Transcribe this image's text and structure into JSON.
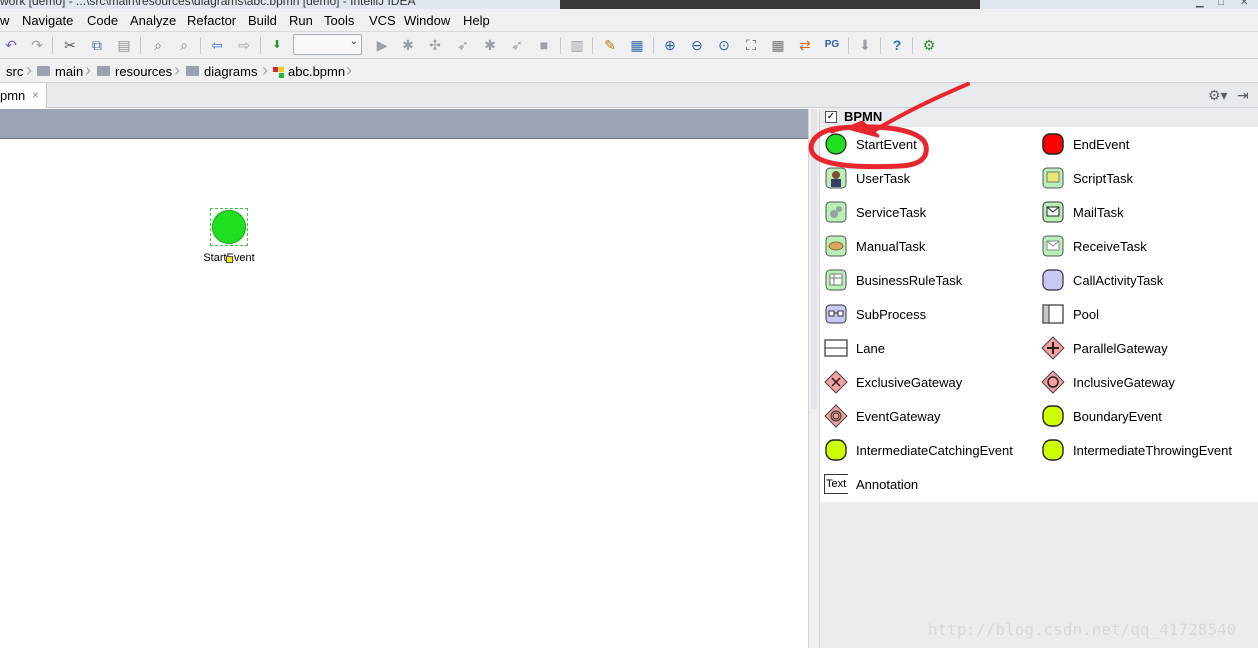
{
  "window": {
    "title": "work [demo] - ...\\src\\main\\resources\\diagrams\\abc.bpmn [demo] - IntelliJ IDEA"
  },
  "menu": {
    "items": [
      "w",
      "Navigate",
      "Code",
      "Analyze",
      "Refactor",
      "Build",
      "Run",
      "Tools",
      "VCS",
      "Window",
      "Help"
    ]
  },
  "toolbar": {
    "combo_value": ""
  },
  "breadcrumbs": [
    "src",
    "main",
    "resources",
    "diagrams",
    "abc.bpmn"
  ],
  "editor": {
    "tab_label": "pmn",
    "tab_close": "×",
    "node_label": "StartEvent"
  },
  "palette": {
    "section_label": "BPMN",
    "section_checked": "✓",
    "items": [
      {
        "label": "StartEvent",
        "icon": "start-event-icon"
      },
      {
        "label": "EndEvent",
        "icon": "end-event-icon"
      },
      {
        "label": "UserTask",
        "icon": "user-task-icon"
      },
      {
        "label": "ScriptTask",
        "icon": "script-task-icon"
      },
      {
        "label": "ServiceTask",
        "icon": "service-task-icon"
      },
      {
        "label": "MailTask",
        "icon": "mail-task-icon"
      },
      {
        "label": "ManualTask",
        "icon": "manual-task-icon"
      },
      {
        "label": "ReceiveTask",
        "icon": "receive-task-icon"
      },
      {
        "label": "BusinessRuleTask",
        "icon": "business-rule-task-icon"
      },
      {
        "label": "CallActivityTask",
        "icon": "call-activity-task-icon"
      },
      {
        "label": "SubProcess",
        "icon": "subprocess-icon"
      },
      {
        "label": "Pool",
        "icon": "pool-icon"
      },
      {
        "label": "Lane",
        "icon": "lane-icon"
      },
      {
        "label": "ParallelGateway",
        "icon": "parallel-gateway-icon"
      },
      {
        "label": "ExclusiveGateway",
        "icon": "exclusive-gateway-icon"
      },
      {
        "label": "InclusiveGateway",
        "icon": "inclusive-gateway-icon"
      },
      {
        "label": "EventGateway",
        "icon": "event-gateway-icon"
      },
      {
        "label": "BoundaryEvent",
        "icon": "boundary-event-icon"
      },
      {
        "label": "IntermediateCatchingEvent",
        "icon": "intermediate-catching-event-icon"
      },
      {
        "label": "IntermediateThrowingEvent",
        "icon": "intermediate-throwing-event-icon"
      },
      {
        "label": "Annotation",
        "icon": "annotation-icon"
      }
    ],
    "annotation_icon_text": "Text"
  },
  "watermark": "http://blog.csdn.net/qq_41728540",
  "colors": {
    "start_event": "#1fe01f",
    "end_event": "#ff0000",
    "task_fill": "#b8f0b8",
    "gateway_fill": "#f5a0a0",
    "intermediate_event": "#ccff00",
    "call_activity_fill": "#c8c8f5",
    "highlight_annotation": "#e8262e"
  }
}
